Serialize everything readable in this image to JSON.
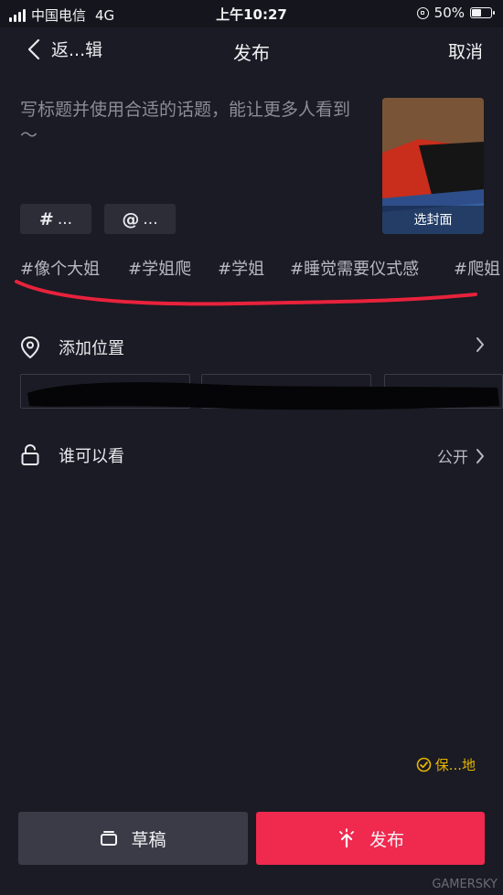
{
  "status_bar": {
    "carrier": "中国电信",
    "network": "4G",
    "time": "上午10:27",
    "battery_pct": "50%",
    "battery_level": 0.5
  },
  "nav": {
    "back_label": "返...辑",
    "title": "发布",
    "cancel_label": "取消"
  },
  "caption": {
    "placeholder": "写标题并使用合适的话题，能让更多人看到～"
  },
  "cover": {
    "label": "选封面"
  },
  "chips": {
    "hashtag_symbol": "#",
    "hashtag_text": "...",
    "mention_symbol": "@",
    "mention_text": "..."
  },
  "hashtags": [
    "#像个大姐",
    "#学姐爬",
    "#学姐",
    "#睡觉需要仪式感",
    "#爬姐"
  ],
  "location": {
    "label": "添加位置"
  },
  "privacy": {
    "label": "谁可以看",
    "value": "公开"
  },
  "save_local": {
    "label": "保...地"
  },
  "buttons": {
    "draft": "草稿",
    "publish": "发布"
  },
  "watermark": "GAMERSKY",
  "colors": {
    "background": "#1a1b24",
    "publish": "#f0294f",
    "draft": "#3a3b46",
    "save_local": "#e7b400",
    "annotation": "#e8223c"
  },
  "icons": {
    "back": "chevron-left-icon",
    "location": "location-pin-icon",
    "privacy": "unlock-icon",
    "chevron": "chevron-right-icon",
    "save_local": "check-circle-icon",
    "draft": "draft-box-icon",
    "publish": "sparkle-arrow-up-icon"
  }
}
